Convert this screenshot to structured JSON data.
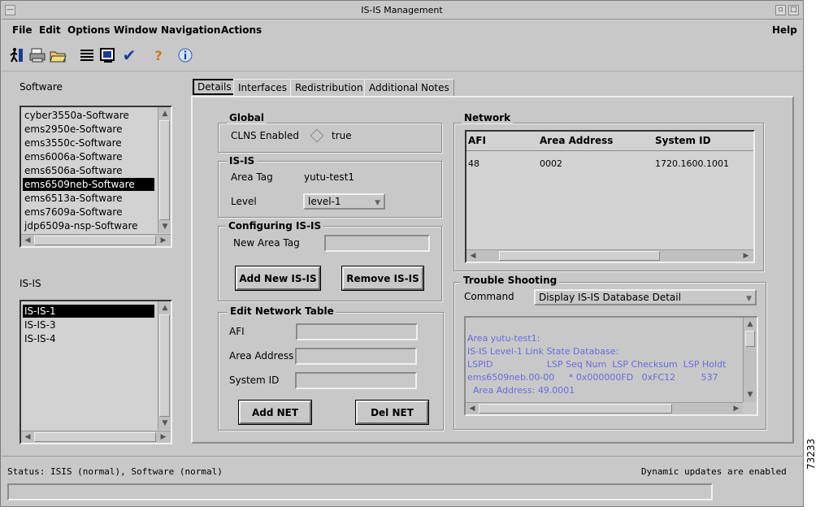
{
  "window": {
    "title": "IS-IS Management"
  },
  "menu": [
    {
      "label": "File",
      "u": "F"
    },
    {
      "label": "Edit",
      "u": "E"
    },
    {
      "label": "Options",
      "u": "O"
    },
    {
      "label": "Window",
      "u": "W"
    },
    {
      "label": "Navigation",
      "u": "N"
    },
    {
      "label": "Actions",
      "u": "A"
    }
  ],
  "help_menu": "Help",
  "toolbar": [
    "exit-icon",
    "print-icon",
    "open-folder-icon",
    "list-icon",
    "screen-icon",
    "check-icon",
    "help-icon",
    "info-icon"
  ],
  "software": {
    "label": "Software",
    "items": [
      "cyber3550a-Software",
      "ems2950e-Software",
      "ems3550c-Software",
      "ems6006a-Software",
      "ems6506a-Software",
      "ems6509neb-Software",
      "ems6513a-Software",
      "ems7609a-Software",
      "jdp6509a-nsp-Software"
    ],
    "selected": 5
  },
  "isis_list": {
    "label": "IS-IS",
    "items": [
      "IS-IS-1",
      "IS-IS-3",
      "IS-IS-4"
    ],
    "selected": 0
  },
  "tabs": [
    "Details",
    "Interfaces",
    "Redistribution",
    "Additional Notes"
  ],
  "global": {
    "title": "Global",
    "clns_label": "CLNS Enabled",
    "clns_value": "true"
  },
  "isis": {
    "title": "IS-IS",
    "area_tag_label": "Area Tag",
    "area_tag_value": "yutu-test1",
    "level_label": "Level",
    "level_value": "level-1"
  },
  "configuring": {
    "title": "Configuring IS-IS",
    "new_area_tag_label": "New Area Tag",
    "new_area_tag_value": "",
    "add_button": "Add New IS-IS",
    "remove_button": "Remove IS-IS"
  },
  "edit_net": {
    "title": "Edit Network Table",
    "afi_label": "AFI",
    "area_label": "Area Address",
    "sysid_label": "System ID",
    "add_button": "Add NET",
    "del_button": "Del NET"
  },
  "network": {
    "title": "Network",
    "columns": [
      "AFI",
      "Area Address",
      "System ID"
    ],
    "rows": [
      [
        "48",
        "0002",
        "1720.1600.1001"
      ]
    ]
  },
  "trouble": {
    "title": "Trouble Shooting",
    "command_label": "Command",
    "command_value": "Display IS-IS Database Detail",
    "output": [
      "Area yutu-test1:",
      "IS-IS Level-1 Link State Database:",
      "LSPID                   LSP Seq Num  LSP Checksum  LSP Holdt",
      "ems6509neb.00-00     * 0x000000FD   0xFC12         537",
      "  Area Address: 49.0001"
    ]
  },
  "status": {
    "left": "Status: ISIS (normal), Software (normal)",
    "right": "Dynamic updates are enabled"
  },
  "figure_number": "73233"
}
